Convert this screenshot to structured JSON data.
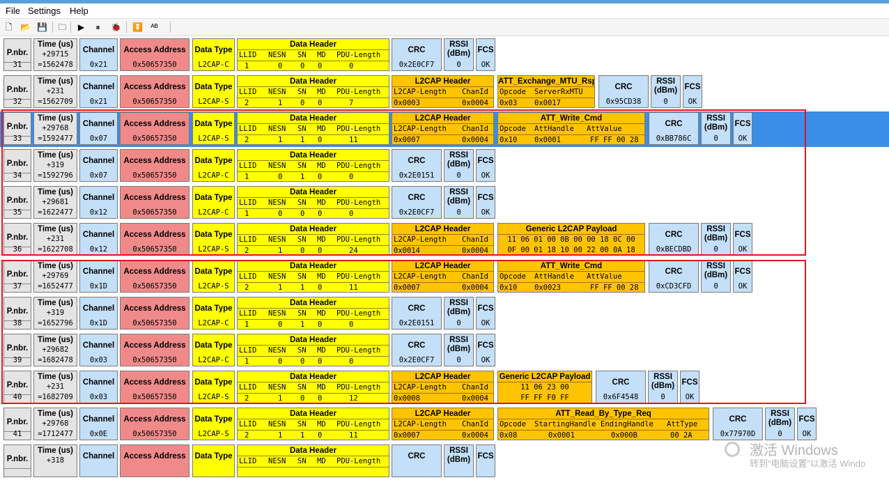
{
  "menu": [
    "File",
    "Settings",
    "Help"
  ],
  "toolbar": [
    {
      "icon": "new-file-icon",
      "glyph": "🗋"
    },
    {
      "icon": "open-folder-icon",
      "glyph": "📂"
    },
    {
      "icon": "save-icon",
      "glyph": "💾"
    },
    {
      "icon": "folder-icon",
      "glyph": "🗀"
    },
    {
      "icon": "play-icon",
      "glyph": "▶"
    },
    {
      "icon": "pause-icon",
      "glyph": "⏸"
    },
    {
      "icon": "bug-icon",
      "glyph": "🐞"
    },
    {
      "icon": "scroll-down-icon",
      "glyph": "⏬"
    },
    {
      "icon": "ab-icon",
      "glyph": "ᴬᴮ"
    }
  ],
  "labels": {
    "pnbr": "P.nbr.",
    "time": "Time (us)",
    "channel": "Channel",
    "access": "Access Address",
    "datatype": "Data Type",
    "dataheader": "Data Header",
    "dh_fields": [
      "LLID",
      "NESN",
      "SN",
      "MD",
      "PDU-Length"
    ],
    "l2cap": "L2CAP Header",
    "l2cap_fields": [
      "L2CAP-Length",
      "ChanId"
    ],
    "crc": "CRC",
    "rssi1": "RSSI",
    "rssi2": "(dBm)",
    "fcs": "FCS"
  },
  "packets": [
    {
      "nbr": "31",
      "t1": "+29715",
      "t2": "=1562478",
      "ch": "0x21",
      "aa": "0x50657350",
      "dt": "L2CAP-C",
      "dh": [
        "1",
        "0",
        "0",
        "0",
        "0"
      ],
      "crc": "0x2E0CF7",
      "rssi": "0",
      "fcs": "OK"
    },
    {
      "nbr": "32",
      "t1": "+231",
      "t2": "=1562709",
      "ch": "0x21",
      "aa": "0x50657350",
      "dt": "L2CAP-S",
      "dh": [
        "2",
        "1",
        "0",
        "0",
        "7"
      ],
      "l2": [
        "0x0003",
        "0x0004"
      ],
      "att": {
        "title": "ATT_Exchange_MTU_Rsp",
        "w": 140,
        "heads": [
          "Opcode",
          "ServerRxMTU"
        ],
        "vals": [
          "0x03",
          "0x0017"
        ]
      },
      "crc": "0x95CD38",
      "rssi": "0",
      "fcs": "OK"
    },
    {
      "nbr": "33",
      "sel": true,
      "t1": "+29768",
      "t2": "=1592477",
      "ch": "0x07",
      "aa": "0x50657350",
      "dt": "L2CAP-S",
      "dh": [
        "2",
        "1",
        "1",
        "0",
        "11"
      ],
      "l2": [
        "0x0007",
        "0x0004"
      ],
      "att": {
        "title": "ATT_Write_Cmd",
        "w": 212,
        "heads": [
          "Opcode",
          "AttHandle",
          "AttValue"
        ],
        "vals": [
          "0x10",
          "0x0001",
          "FF FF 00 28"
        ]
      },
      "crc": "0xBB786C",
      "rssi": "0",
      "fcs": "OK"
    },
    {
      "nbr": "34",
      "t1": "+319",
      "t2": "=1592796",
      "ch": "0x07",
      "aa": "0x50657350",
      "dt": "L2CAP-C",
      "dh": [
        "1",
        "0",
        "1",
        "0",
        "0"
      ],
      "crc": "0x2E0151",
      "rssi": "0",
      "fcs": "OK"
    },
    {
      "nbr": "35",
      "t1": "+29681",
      "t2": "=1622477",
      "ch": "0x12",
      "aa": "0x50657350",
      "dt": "L2CAP-C",
      "dh": [
        "1",
        "0",
        "0",
        "0",
        "0"
      ],
      "crc": "0x2E0CF7",
      "rssi": "0",
      "fcs": "OK"
    },
    {
      "nbr": "36",
      "t1": "+231",
      "t2": "=1622708",
      "ch": "0x12",
      "aa": "0x50657350",
      "dt": "L2CAP-S",
      "dh": [
        "2",
        "1",
        "0",
        "0",
        "24"
      ],
      "l2": [
        "0x0014",
        "0x0004"
      ],
      "att": {
        "title": "Generic L2CAP Payload",
        "w": 212,
        "lines": [
          "11 06 01 00 0B 00 00 18 0C 00",
          "0F 00 01 18 10 00 22 00 0A 18"
        ]
      },
      "crc": "0xBECDBD",
      "rssi": "0",
      "fcs": "OK"
    },
    {
      "nbr": "37",
      "t1": "+29769",
      "t2": "=1652477",
      "ch": "0x1D",
      "aa": "0x50657350",
      "dt": "L2CAP-S",
      "dh": [
        "2",
        "1",
        "1",
        "0",
        "11"
      ],
      "l2": [
        "0x0007",
        "0x0004"
      ],
      "att": {
        "title": "ATT_Write_Cmd",
        "w": 212,
        "heads": [
          "Opcode",
          "AttHandle",
          "AttValue"
        ],
        "vals": [
          "0x10",
          "0x0023",
          "FF FF 00 28"
        ]
      },
      "crc": "0xCD3CFD",
      "rssi": "0",
      "fcs": "OK"
    },
    {
      "nbr": "38",
      "t1": "+319",
      "t2": "=1652796",
      "ch": "0x1D",
      "aa": "0x50657350",
      "dt": "L2CAP-C",
      "dh": [
        "1",
        "0",
        "1",
        "0",
        "0"
      ],
      "crc": "0x2E0151",
      "rssi": "0",
      "fcs": "OK"
    },
    {
      "nbr": "39",
      "t1": "+29682",
      "t2": "=1682478",
      "ch": "0x03",
      "aa": "0x50657350",
      "dt": "L2CAP-C",
      "dh": [
        "1",
        "0",
        "0",
        "0",
        "0"
      ],
      "crc": "0x2E0CF7",
      "rssi": "0",
      "fcs": "OK"
    },
    {
      "nbr": "40",
      "t1": "+231",
      "t2": "=1682709",
      "ch": "0x03",
      "aa": "0x50657350",
      "dt": "L2CAP-S",
      "dh": [
        "2",
        "1",
        "0",
        "0",
        "12"
      ],
      "l2": [
        "0x0008",
        "0x0004"
      ],
      "att": {
        "title": "Generic L2CAP Payload",
        "w": 136,
        "lines": [
          "11 06 23 00",
          "FF FF F0 FF"
        ]
      },
      "crc": "0x6F4548",
      "rssi": "0",
      "fcs": "OK"
    },
    {
      "nbr": "41",
      "t1": "+29768",
      "t2": "=1712477",
      "ch": "0x0E",
      "aa": "0x50657350",
      "dt": "L2CAP-S",
      "dh": [
        "2",
        "1",
        "1",
        "0",
        "11"
      ],
      "l2": [
        "0x0007",
        "0x0004"
      ],
      "att": {
        "title": "ATT_Read_By_Type_Req",
        "w": 304,
        "heads": [
          "Opcode",
          "StartingHandle",
          "EndingHandle",
          "AttType"
        ],
        "vals": [
          "0x08",
          "0x0001",
          "0x000B",
          "00 2A"
        ]
      },
      "crc": "0x77970D",
      "rssi": "0",
      "fcs": "OK"
    },
    {
      "nbr": "",
      "t1": "+318",
      "t2": "",
      "ch": "",
      "aa": "",
      "dt": "",
      "dh": [
        "",
        "",
        "",
        "",
        ""
      ],
      "crc": "",
      "rssi": "",
      "fcs": ""
    }
  ],
  "watermark": {
    "line1": "激活 Windows",
    "line2": "转到“电脑设置”以激活 Windo"
  }
}
